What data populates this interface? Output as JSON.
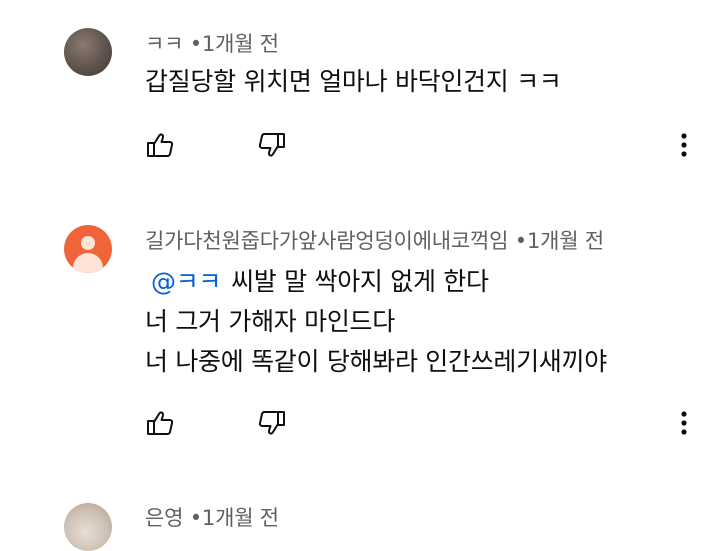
{
  "comments": [
    {
      "author": "ㅋㅋ",
      "time": "1개월 전",
      "lines": [
        "갑질당할 위치면 얼마나 바닥인건지 ㅋㅋ"
      ]
    },
    {
      "author": "길가다천원줍다가앞사람엉덩이에내코꺽임",
      "time": "1개월 전",
      "mention": "@ㅋㅋ",
      "lines": [
        "씨발 말 싹아지 없게 한다",
        "너 그거 가해자 마인드다",
        "너 나중에 똑같이 당해봐라 인간쓰레기새끼야"
      ]
    },
    {
      "author": "은영",
      "time": "1개월 전"
    }
  ],
  "separator": "•",
  "icons": {
    "like": "thumbs-up-icon",
    "dislike": "thumbs-down-icon",
    "more": "more-vertical-icon"
  },
  "colors": {
    "meta_text": "#606060",
    "mention": "#065fd4",
    "avatar_orange": "#f0643a"
  }
}
